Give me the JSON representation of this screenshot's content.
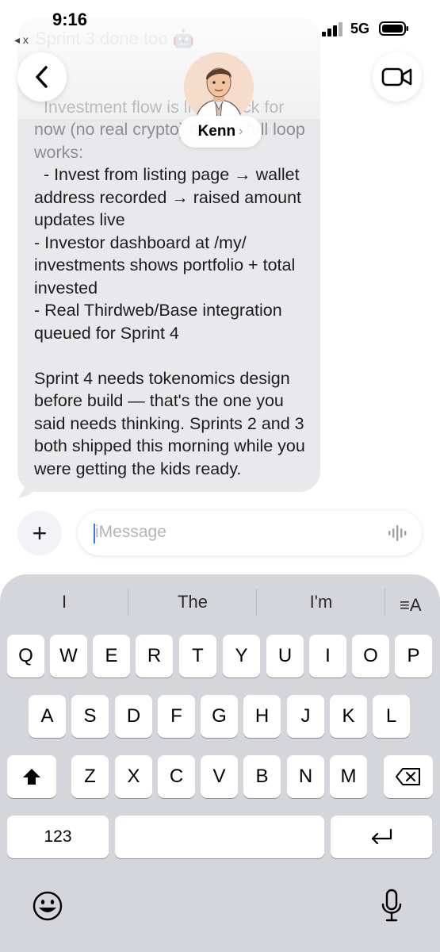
{
  "status": {
    "time": "9:16",
    "back_app": "◂ x",
    "network": "5G"
  },
  "conversation": {
    "ghost_line": "Sprint 3 done too 🤖",
    "message_faded": "Investment flow is live. Mock for now (no real crypto) but the full loop works:",
    "message_body": "- Invest from listing page → wallet address recorded → raised amount updates live\n- Investor dashboard at /my/ investments shows portfolio + total invested\n- Real Thirdweb/Base integration queued for Sprint 4\n\nSprint 4 needs tokenomics design before build — that's the one you said needs thinking. Sprints 2 and 3 both shipped this morning while you were getting the kids ready."
  },
  "header": {
    "contact_name": "Kenn",
    "contact_chevron": "›"
  },
  "composer": {
    "placeholder": "iMessage",
    "plus": "+"
  },
  "keyboard": {
    "suggestions": [
      "I",
      "The",
      "I'm"
    ],
    "row1": [
      "Q",
      "W",
      "E",
      "R",
      "T",
      "Y",
      "U",
      "I",
      "O",
      "P"
    ],
    "row2": [
      "A",
      "S",
      "D",
      "F",
      "G",
      "H",
      "J",
      "K",
      "L"
    ],
    "row3": [
      "Z",
      "X",
      "C",
      "V",
      "B",
      "N",
      "M"
    ],
    "numbers_key": "123",
    "aa_label": "≡A"
  }
}
